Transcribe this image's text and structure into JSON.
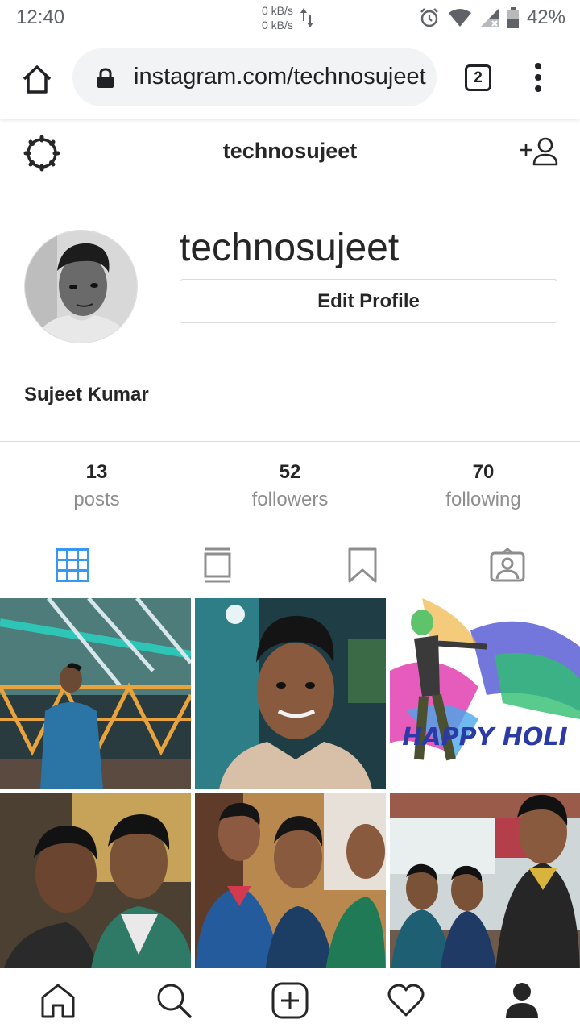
{
  "status_bar": {
    "time": "12:40",
    "net_up": "0 kB/s",
    "net_down": "0 kB/s",
    "battery": "42%"
  },
  "browser": {
    "url": "instagram.com/technosujeet",
    "tab_count": "2"
  },
  "header": {
    "title": "technosujeet"
  },
  "profile": {
    "username": "technosujeet",
    "edit_label": "Edit Profile",
    "full_name": "Sujeet Kumar"
  },
  "stats": [
    {
      "count": "13",
      "label": "posts"
    },
    {
      "count": "52",
      "label": "followers"
    },
    {
      "count": "70",
      "label": "following"
    }
  ],
  "view_tabs": [
    {
      "icon": "grid-icon",
      "active": true
    },
    {
      "icon": "feed-icon",
      "active": false
    },
    {
      "icon": "bookmark-icon",
      "active": false
    },
    {
      "icon": "tagged-icon",
      "active": false
    }
  ],
  "posts": [
    {
      "caption_overlay": ""
    },
    {
      "caption_overlay": ""
    },
    {
      "caption_overlay": "HAPPY HOLI"
    },
    {
      "caption_overlay": ""
    },
    {
      "caption_overlay": ""
    },
    {
      "caption_overlay": ""
    }
  ],
  "bottom_nav": [
    "home-icon",
    "search-icon",
    "new-post-icon",
    "activity-heart-icon",
    "profile-icon"
  ],
  "colors": {
    "accent_blue": "#3897f0",
    "text": "#262626",
    "muted": "#8e8e8e",
    "border": "#dbdbdb"
  }
}
